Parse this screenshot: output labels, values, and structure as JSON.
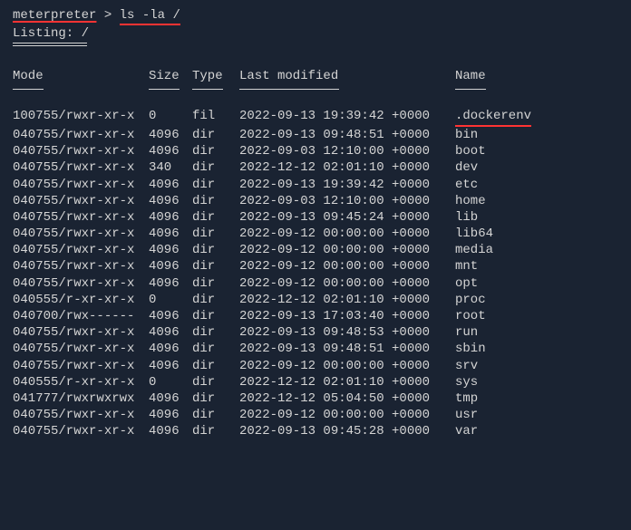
{
  "prompt": {
    "label": "meterpreter",
    "separator": " > ",
    "command": "ls -la /"
  },
  "listing_label": "Listing: /",
  "headers": {
    "mode": "Mode",
    "size": "Size",
    "type": "Type",
    "modified": "Last modified",
    "name": "Name"
  },
  "rows": [
    {
      "mode": "100755/rwxr-xr-x",
      "size": "0",
      "type": "fil",
      "modified": "2022-09-13 19:39:42 +0000",
      "name": ".dockerenv",
      "highlight": true
    },
    {
      "mode": "040755/rwxr-xr-x",
      "size": "4096",
      "type": "dir",
      "modified": "2022-09-13 09:48:51 +0000",
      "name": "bin"
    },
    {
      "mode": "040755/rwxr-xr-x",
      "size": "4096",
      "type": "dir",
      "modified": "2022-09-03 12:10:00 +0000",
      "name": "boot"
    },
    {
      "mode": "040755/rwxr-xr-x",
      "size": "340",
      "type": "dir",
      "modified": "2022-12-12 02:01:10 +0000",
      "name": "dev"
    },
    {
      "mode": "040755/rwxr-xr-x",
      "size": "4096",
      "type": "dir",
      "modified": "2022-09-13 19:39:42 +0000",
      "name": "etc"
    },
    {
      "mode": "040755/rwxr-xr-x",
      "size": "4096",
      "type": "dir",
      "modified": "2022-09-03 12:10:00 +0000",
      "name": "home"
    },
    {
      "mode": "040755/rwxr-xr-x",
      "size": "4096",
      "type": "dir",
      "modified": "2022-09-13 09:45:24 +0000",
      "name": "lib"
    },
    {
      "mode": "040755/rwxr-xr-x",
      "size": "4096",
      "type": "dir",
      "modified": "2022-09-12 00:00:00 +0000",
      "name": "lib64"
    },
    {
      "mode": "040755/rwxr-xr-x",
      "size": "4096",
      "type": "dir",
      "modified": "2022-09-12 00:00:00 +0000",
      "name": "media"
    },
    {
      "mode": "040755/rwxr-xr-x",
      "size": "4096",
      "type": "dir",
      "modified": "2022-09-12 00:00:00 +0000",
      "name": "mnt"
    },
    {
      "mode": "040755/rwxr-xr-x",
      "size": "4096",
      "type": "dir",
      "modified": "2022-09-12 00:00:00 +0000",
      "name": "opt"
    },
    {
      "mode": "040555/r-xr-xr-x",
      "size": "0",
      "type": "dir",
      "modified": "2022-12-12 02:01:10 +0000",
      "name": "proc"
    },
    {
      "mode": "040700/rwx------",
      "size": "4096",
      "type": "dir",
      "modified": "2022-09-13 17:03:40 +0000",
      "name": "root"
    },
    {
      "mode": "040755/rwxr-xr-x",
      "size": "4096",
      "type": "dir",
      "modified": "2022-09-13 09:48:53 +0000",
      "name": "run"
    },
    {
      "mode": "040755/rwxr-xr-x",
      "size": "4096",
      "type": "dir",
      "modified": "2022-09-13 09:48:51 +0000",
      "name": "sbin"
    },
    {
      "mode": "040755/rwxr-xr-x",
      "size": "4096",
      "type": "dir",
      "modified": "2022-09-12 00:00:00 +0000",
      "name": "srv"
    },
    {
      "mode": "040555/r-xr-xr-x",
      "size": "0",
      "type": "dir",
      "modified": "2022-12-12 02:01:10 +0000",
      "name": "sys"
    },
    {
      "mode": "041777/rwxrwxrwx",
      "size": "4096",
      "type": "dir",
      "modified": "2022-12-12 05:04:50 +0000",
      "name": "tmp"
    },
    {
      "mode": "040755/rwxr-xr-x",
      "size": "4096",
      "type": "dir",
      "modified": "2022-09-12 00:00:00 +0000",
      "name": "usr"
    },
    {
      "mode": "040755/rwxr-xr-x",
      "size": "4096",
      "type": "dir",
      "modified": "2022-09-13 09:45:28 +0000",
      "name": "var"
    }
  ]
}
